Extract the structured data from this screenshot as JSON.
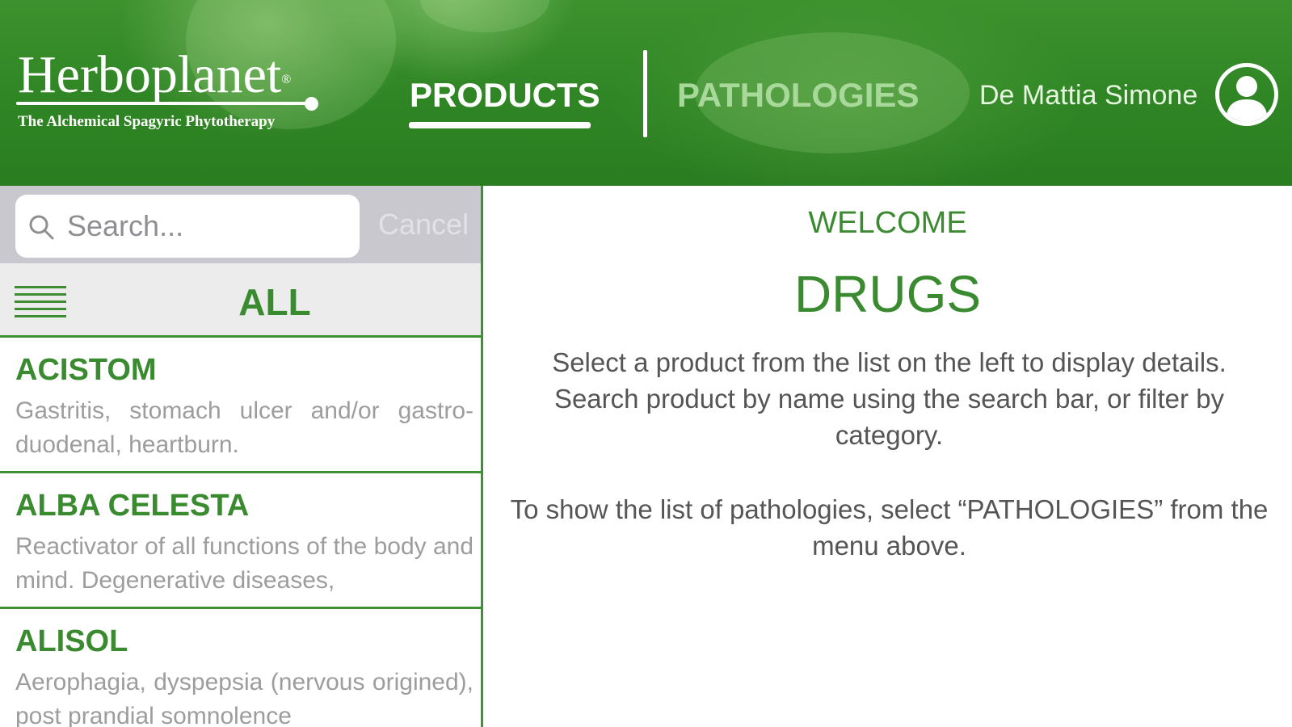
{
  "header": {
    "logo": {
      "title": "Herboplanet",
      "registered": "®",
      "subtitle": "The Alchemical Spagyric Phytotherapy"
    },
    "nav": {
      "products_label": "PRODUCTS",
      "pathologies_label": "PATHOLOGIES",
      "active": "PRODUCTS"
    },
    "user": {
      "name": "De Mattia Simone",
      "avatar_icon": "user-avatar-icon"
    }
  },
  "sidebar": {
    "search": {
      "placeholder": "Search...",
      "value": "",
      "cancel_label": "Cancel",
      "icon": "search-icon"
    },
    "filter": {
      "menu_icon": "hamburger-menu-icon",
      "label": "ALL"
    },
    "products": [
      {
        "name": "ACISTOM",
        "description": "Gastritis, stomach ulcer and/or gastro-duodenal, heartburn."
      },
      {
        "name": "ALBA CELESTA",
        "description": "Reactivator of all functions of the body and mind. Degenerative diseases,"
      },
      {
        "name": "ALISOL",
        "description": "Aerophagia, dyspepsia (nervous origined), post prandial somnolence"
      }
    ]
  },
  "main": {
    "welcome": "WELCOME",
    "title": "DRUGS",
    "paragraph1": "Select a product from the list on the left to display details. Search product by name using the search bar, or filter by category.",
    "paragraph2": "To show the list of pathologies, select “PATHOLOGIES” from the menu above."
  },
  "colors": {
    "brand_green": "#3a8a30",
    "header_green": "#2f8524",
    "inactive_tab": "#a8d99a",
    "muted_text": "#9d9d9d"
  }
}
